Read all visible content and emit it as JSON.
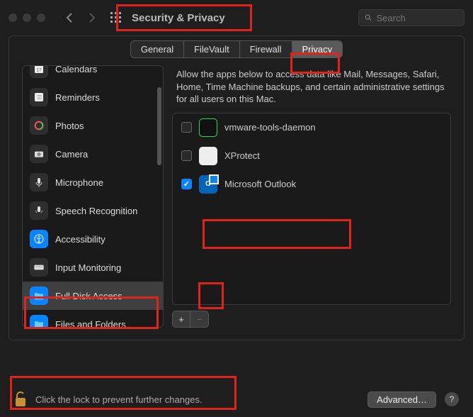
{
  "header": {
    "title": "Security & Privacy",
    "search_placeholder": "Search"
  },
  "tabs": [
    {
      "label": "General",
      "active": false
    },
    {
      "label": "FileVault",
      "active": false
    },
    {
      "label": "Firewall",
      "active": false
    },
    {
      "label": "Privacy",
      "active": true
    }
  ],
  "sidebar": {
    "items": [
      {
        "label": "Calendars",
        "icon": "calendar-icon"
      },
      {
        "label": "Reminders",
        "icon": "reminders-icon"
      },
      {
        "label": "Photos",
        "icon": "photos-icon"
      },
      {
        "label": "Camera",
        "icon": "camera-icon"
      },
      {
        "label": "Microphone",
        "icon": "microphone-icon"
      },
      {
        "label": "Speech Recognition",
        "icon": "speech-icon"
      },
      {
        "label": "Accessibility",
        "icon": "accessibility-icon",
        "blue": true
      },
      {
        "label": "Input Monitoring",
        "icon": "keyboard-icon"
      },
      {
        "label": "Full Disk Access",
        "icon": "folder-icon",
        "blue": true,
        "selected": true
      },
      {
        "label": "Files and Folders",
        "icon": "folder-icon",
        "blue": true
      }
    ]
  },
  "description": "Allow the apps below to access data like Mail, Messages, Safari, Home, Time Machine backups, and certain administrative settings for all users on this Mac.",
  "apps": [
    {
      "name": "vmware-tools-daemon",
      "checked": false,
      "icon": "terminal"
    },
    {
      "name": "XProtect",
      "checked": false,
      "icon": "white"
    },
    {
      "name": "Microsoft Outlook",
      "checked": true,
      "icon": "outlook"
    }
  ],
  "buttons": {
    "add": "+",
    "remove": "−",
    "advanced": "Advanced…",
    "help": "?"
  },
  "lock_text": "Click the lock to prevent further changes.",
  "colors": {
    "accent": "#0a84ff",
    "highlight": "#e1241b"
  }
}
